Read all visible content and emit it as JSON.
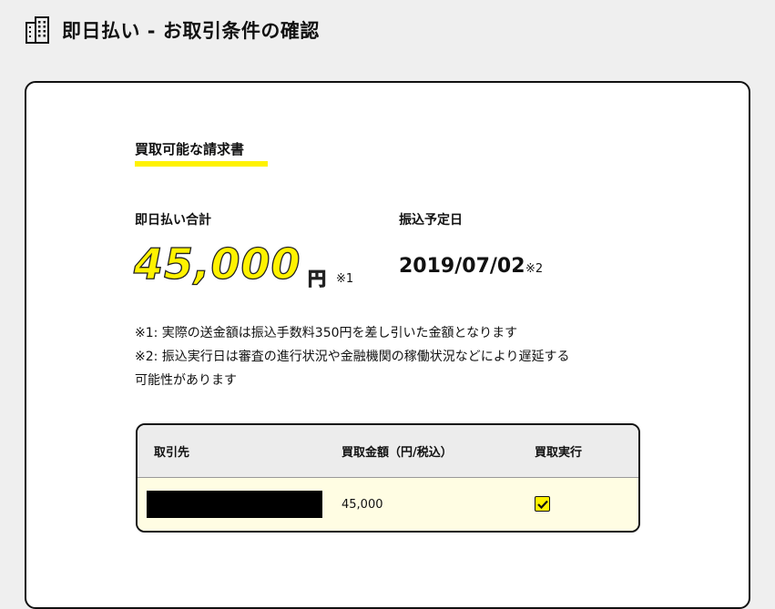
{
  "header": {
    "title": "即日払い - お取引条件の確認",
    "icon": "building-icon"
  },
  "card": {
    "section_heading": "買取可能な請求書",
    "total": {
      "label": "即日払い合計",
      "amount": "45,000",
      "unit": "円",
      "note_mark": "※1"
    },
    "transfer": {
      "label": "振込予定日",
      "date": "2019/07/02",
      "note_mark": "※2"
    },
    "notes": [
      "※1: 実際の送金額は振込手数料350円を差し引いた金額となります",
      "※2: 振込実行日は審査の進行状況や金融機関の稼働状況などにより遅延する",
      "可能性があります"
    ],
    "table": {
      "headers": [
        "取引先",
        "買取金額（円/税込）",
        "買取実行"
      ],
      "rows": [
        {
          "partner": "",
          "amount": "45,000",
          "execute": true
        }
      ]
    }
  },
  "colors": {
    "accent_yellow": "#fff200",
    "row_background": "#fffde3",
    "header_background": "#ececec"
  }
}
